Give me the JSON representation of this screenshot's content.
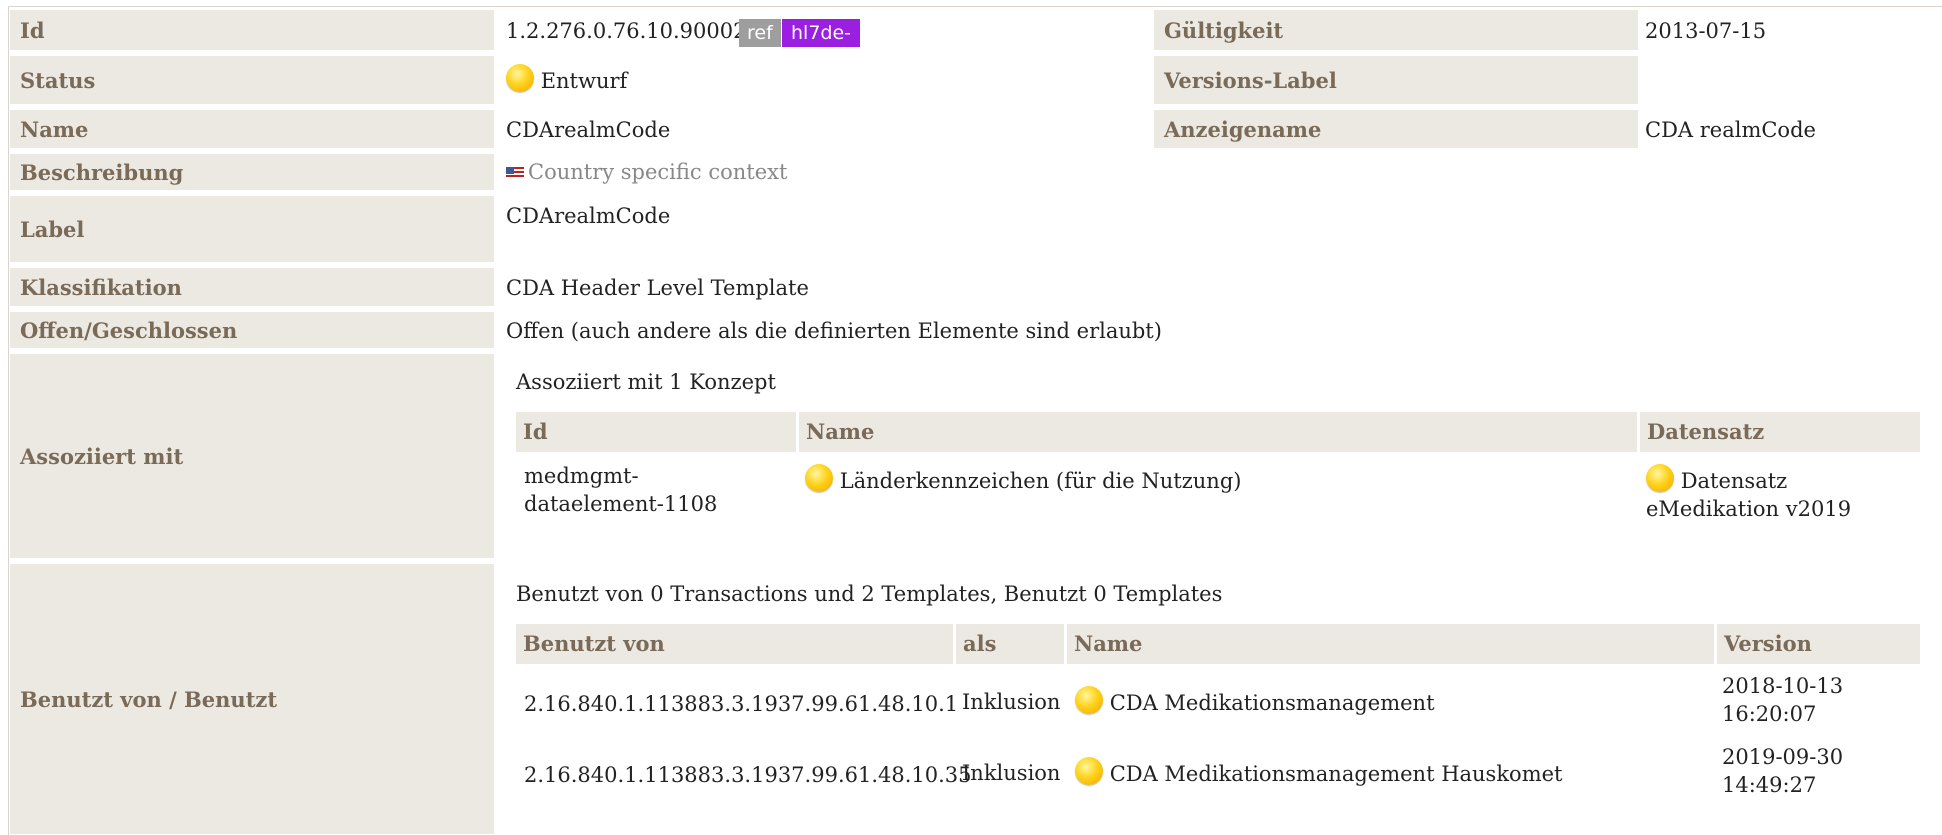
{
  "rows": {
    "id": {
      "label": "Id",
      "value": "1.2.276.0.76.10.90002",
      "tag_ref": "ref",
      "tag_hl7": "hl7de-"
    },
    "gueltigkeit": {
      "label": "Gültigkeit",
      "value": "2013-07-15"
    },
    "status": {
      "label": "Status",
      "value": "Entwurf",
      "icon": "status-draft-icon"
    },
    "versions_label": {
      "label": "Versions-Label",
      "value": ""
    },
    "name": {
      "label": "Name",
      "value": "CDArealmCode"
    },
    "anzeigename": {
      "label": "Anzeigename",
      "value": "CDA realmCode"
    },
    "beschreibung": {
      "label": "Beschreibung",
      "value": "Country specific context",
      "icon": "us-flag-icon"
    },
    "label": {
      "label": "Label",
      "value": "CDArealmCode"
    },
    "klassifikation": {
      "label": "Klassifikation",
      "value": "CDA Header Level Template"
    },
    "offen": {
      "label": "Offen/Geschlossen",
      "value": "Offen (auch andere als die definierten Elemente sind erlaubt)"
    },
    "assoziiert": {
      "label": "Assoziiert mit"
    },
    "benutzt": {
      "label": "Benutzt von / Benutzt"
    }
  },
  "associated": {
    "summary": "Assoziiert mit 1 Konzept",
    "headers": {
      "id": "Id",
      "name": "Name",
      "datensatz": "Datensatz"
    },
    "rows": [
      {
        "id_line1": "medmgmt-",
        "id_line2": "dataelement-1108",
        "name": "Länderkennzeichen (für die Nutzung)",
        "datensatz_line1": "Datensatz",
        "datensatz_line2": "eMedikation v2019"
      }
    ]
  },
  "used_by": {
    "summary": "Benutzt von 0 Transactions und 2 Templates, Benutzt 0 Templates",
    "headers": {
      "benutzt_von": "Benutzt von",
      "als": "als",
      "name": "Name",
      "version": "Version"
    },
    "rows": [
      {
        "benutzt_von": "2.16.840.1.113883.3.1937.99.61.48.10.1",
        "als": "Inklusion",
        "name": "CDA Medikationsmanagement",
        "version_date": "2018-10-13",
        "version_time": "16:20:07"
      },
      {
        "benutzt_von": "2.16.840.1.113883.3.1937.99.61.48.10.35",
        "als": "Inklusion",
        "name": "CDA Medikationsmanagement Hauskomet",
        "version_date": "2019-09-30",
        "version_time": "14:49:27"
      }
    ]
  },
  "colors": {
    "label_bg": "#ece8e2",
    "label_text": "#7a6a58",
    "tag_ref": "#9e9e9e",
    "tag_hl7": "#9a1fe0",
    "status_sun": "#ffd21a"
  }
}
